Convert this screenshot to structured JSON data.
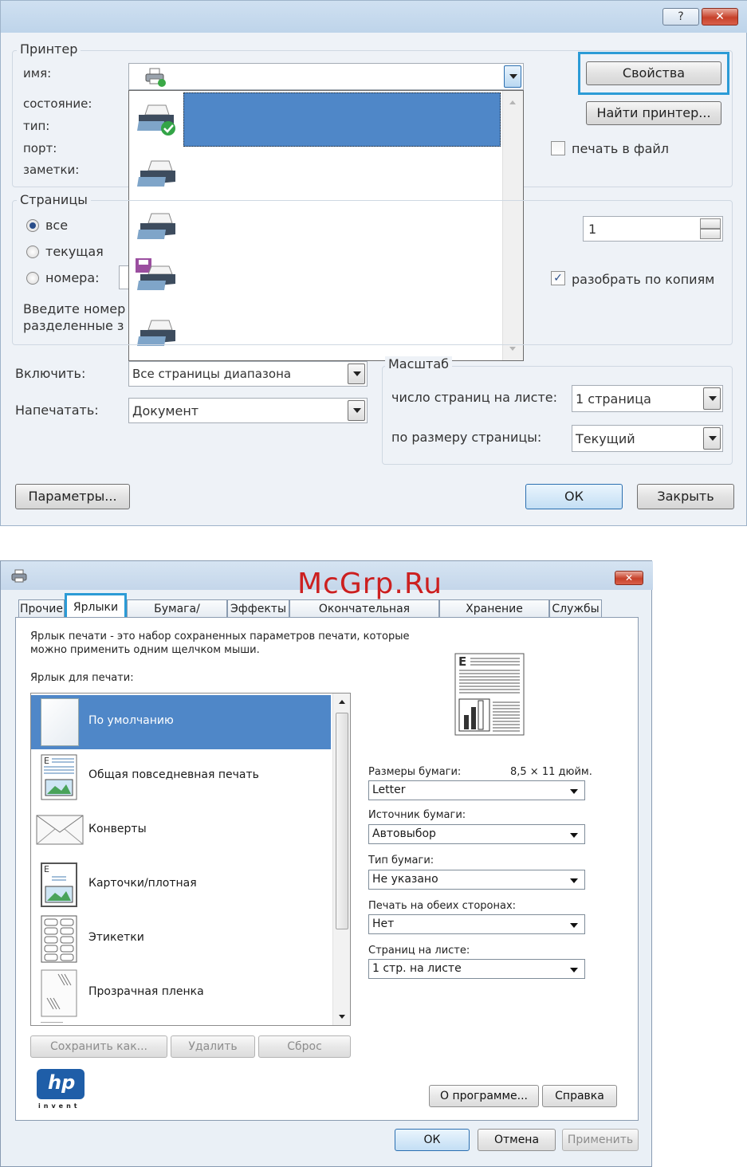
{
  "print_dialog": {
    "help_glyph": "?",
    "close_glyph": "✕",
    "printer_group": {
      "title": "Принтер",
      "name_label": "имя:",
      "status_label": "состояние:",
      "type_label": "тип:",
      "port_label": "порт:",
      "notes_label": "заметки:",
      "properties_button": "Свойства",
      "find_printer_button": "Найти принтер...",
      "print_to_file_label": "печать в файл"
    },
    "printer_dropdown": {
      "items": [
        "printer-default-icon",
        "printer-icon",
        "printer-icon",
        "printer-fax-icon",
        "printer-icon"
      ]
    },
    "pages_group": {
      "title": "Страницы",
      "radio_all": "все",
      "radio_current": "текущая",
      "radio_pages": "номера:",
      "hint_line1": "Введите номер",
      "hint_line2": "разделенные з",
      "copies_value": "1",
      "collate_label": "разобрать по копиям",
      "collate_checked": "✓"
    },
    "include_label": "Включить:",
    "include_value": "Все страницы диапазона",
    "print_label": "Напечатать:",
    "print_value": "Документ",
    "scale_group": {
      "title": "Масштаб",
      "pages_per_sheet_label": "число страниц на листе:",
      "pages_per_sheet_value": "1 страница",
      "fit_label": "по размеру страницы:",
      "fit_value": "Текущий"
    },
    "options_button": "Параметры...",
    "ok_button": "ОК",
    "close_button": "Закрыть"
  },
  "properties_dialog": {
    "watermark": "McGrp.Ru",
    "close_glyph": "✕",
    "tabs": [
      "Прочие",
      "Ярлыки",
      "Бумага/качество",
      "Эффекты",
      "Окончательная обработка",
      "Хранение заданий",
      "Службы"
    ],
    "description_line1": "Ярлык печати - это набор сохраненных параметров печати, которые",
    "description_line2": "можно применить одним щелчком мыши.",
    "shortcuts_label": "Ярлык для печати:",
    "shortcuts": [
      {
        "label": "По умолчанию",
        "icon": "blank-page-icon"
      },
      {
        "label": "Общая повседневная печать",
        "icon": "document-page-icon"
      },
      {
        "label": "Конверты",
        "icon": "envelope-icon"
      },
      {
        "label": "Карточки/плотная",
        "icon": "card-icon"
      },
      {
        "label": "Этикетки",
        "icon": "labels-icon"
      },
      {
        "label": "Прозрачная пленка",
        "icon": "transparency-icon"
      }
    ],
    "paper_size_label": "Размеры бумаги:",
    "paper_size_dims": "8,5 × 11 дюйм.",
    "paper_size_value": "Letter",
    "paper_source_label": "Источник бумаги:",
    "paper_source_value": "Автовыбор",
    "paper_type_label": "Тип бумаги:",
    "paper_type_value": "Не указано",
    "duplex_label": "Печать на обеих сторонах:",
    "duplex_value": "Нет",
    "pages_per_sheet_label": "Страниц на листе:",
    "pages_per_sheet_value": "1 стр. на листе",
    "save_as_button": "Сохранить как...",
    "delete_button": "Удалить",
    "reset_button": "Сброс",
    "hp_logo_text": "hp",
    "hp_invent": "invent",
    "about_button": "О программе...",
    "help_button": "Справка",
    "ok_button": "ОК",
    "cancel_button": "Отмена",
    "apply_button": "Применить",
    "colors": {
      "selection": "#4f87c8",
      "highlight_frame": "#2b9bd6"
    }
  }
}
